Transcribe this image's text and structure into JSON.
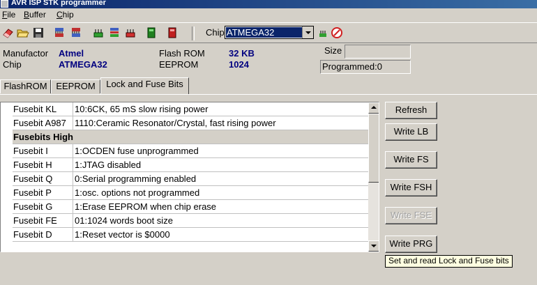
{
  "window": {
    "title": "AVR ISP STK programmer"
  },
  "menu": [
    {
      "label": "File",
      "u": "F",
      "rest": "ile"
    },
    {
      "label": "Buffer",
      "u": "B",
      "rest": "uffer"
    },
    {
      "label": "Chip",
      "u": "C",
      "rest": "hip"
    }
  ],
  "toolbar": {
    "chip_label": "Chip",
    "chip_value": "ATMEGA32",
    "icons": [
      "eraser-icon",
      "open-folder-icon",
      "save-icon",
      "chip-read-icon",
      "chip-write-icon",
      "chip-green-icon",
      "chip-multi-icon",
      "chip-red-icon",
      "green-device-icon",
      "red-device-icon"
    ]
  },
  "info": {
    "manufactor_label": "Manufactor",
    "manufactor_value": "Atmel",
    "chip_label": "Chip",
    "chip_value": "ATMEGA32",
    "flash_label": "Flash ROM",
    "flash_value": "32 KB",
    "eeprom_label": "EEPROM",
    "eeprom_value": "1024",
    "size_label": "Size",
    "size_value": "",
    "programmed": "Programmed:0"
  },
  "tabs": [
    {
      "label": "FlashROM"
    },
    {
      "label": "EEPROM"
    },
    {
      "label": "Lock and Fuse Bits"
    }
  ],
  "fuse_rows": [
    {
      "name": "Fusebit KL",
      "value": "10:6CK, 65 mS slow rising power"
    },
    {
      "name": "Fusebit A987",
      "value": "1110:Ceramic Resonator/Crystal, fast rising power"
    },
    {
      "name": "",
      "value": "Fusebits High",
      "header": true
    },
    {
      "name": "Fusebit I",
      "value": "1:OCDEN fuse unprogrammed"
    },
    {
      "name": "Fusebit H",
      "value": "1:JTAG disabled"
    },
    {
      "name": "Fusebit Q",
      "value": "0:Serial programming enabled"
    },
    {
      "name": "Fusebit P",
      "value": "1:osc. options not programmed"
    },
    {
      "name": "Fusebit G",
      "value": "1:Erase EEPROM when chip erase"
    },
    {
      "name": "Fusebit FE",
      "value": "01:1024 words boot size"
    },
    {
      "name": "Fusebit D",
      "value": "1:Reset vector is $0000"
    }
  ],
  "buttons": [
    {
      "label": "Refresh"
    },
    {
      "label": "Write LB"
    },
    {
      "label": "Write FS"
    },
    {
      "label": "Write FSH"
    },
    {
      "label": "Write FSE",
      "disabled": true
    },
    {
      "label": "Write PRG"
    }
  ],
  "tooltip": "Set and read Lock and Fuse bits"
}
